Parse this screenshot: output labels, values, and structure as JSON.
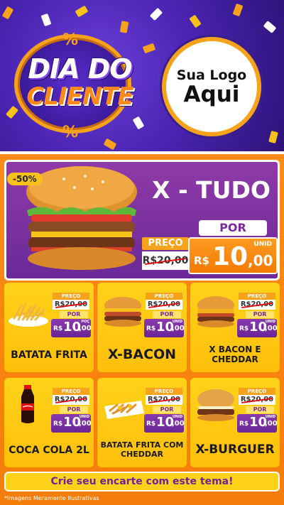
{
  "header": {
    "title_line1": "DIA DO",
    "title_line2": "CLIENTE",
    "percent_symbol": "%",
    "logo_line1": "Sua Logo",
    "logo_line2": "Aqui"
  },
  "featured": {
    "discount_badge": "-50%",
    "name": "X - TUDO",
    "por_label": "POR",
    "preco_label": "PREÇO",
    "old_price": "R$20,00",
    "currency": "R$",
    "price_int": "10",
    "price_dec": ",00",
    "unit": "UNID"
  },
  "products": [
    {
      "name": "BATATA FRITA",
      "preco_label": "PREÇO",
      "old_price": "R$20,00",
      "por_label": "POR",
      "currency": "R$",
      "price_int": "10",
      "price_dec": ",00",
      "unit": "POÇ",
      "icon": "fries-icon"
    },
    {
      "name": "X-BACON",
      "preco_label": "PREÇO",
      "old_price": "R$20,00",
      "por_label": "POR",
      "currency": "R$",
      "price_int": "10",
      "price_dec": ",00",
      "unit": "UNID",
      "icon": "burger-icon"
    },
    {
      "name": "X BACON E CHEDDAR",
      "preco_label": "PREÇO",
      "old_price": "R$20,00",
      "por_label": "POR",
      "currency": "R$",
      "price_int": "10",
      "price_dec": ",00",
      "unit": "UNID",
      "icon": "burger-icon"
    },
    {
      "name": "COCA COLA 2L",
      "preco_label": "PREÇO",
      "old_price": "R$20,00",
      "por_label": "POR",
      "currency": "R$",
      "price_int": "10",
      "price_dec": ",00",
      "unit": "UNID",
      "icon": "soda-bottle-icon"
    },
    {
      "name": "BATATA FRITA COM CHEDDAR",
      "preco_label": "PREÇO",
      "old_price": "R$20,00",
      "por_label": "POR",
      "currency": "R$",
      "price_int": "10",
      "price_dec": ",00",
      "unit": "UNID",
      "icon": "fries-icon"
    },
    {
      "name": "X-BURGUER",
      "preco_label": "PREÇO",
      "old_price": "R$20,00",
      "por_label": "POR",
      "currency": "R$",
      "price_int": "10",
      "price_dec": ",00",
      "unit": "UNID",
      "icon": "burger-icon"
    }
  ],
  "footer": {
    "cta": "Crie seu encarte com este tema!",
    "disclaimer": "*Imagens Meramente Ilustrativas"
  },
  "colors": {
    "purple": "#4b25b4",
    "orange": "#f57d0a",
    "yellow": "#ffd21a",
    "price_purple": "#6a2496"
  }
}
